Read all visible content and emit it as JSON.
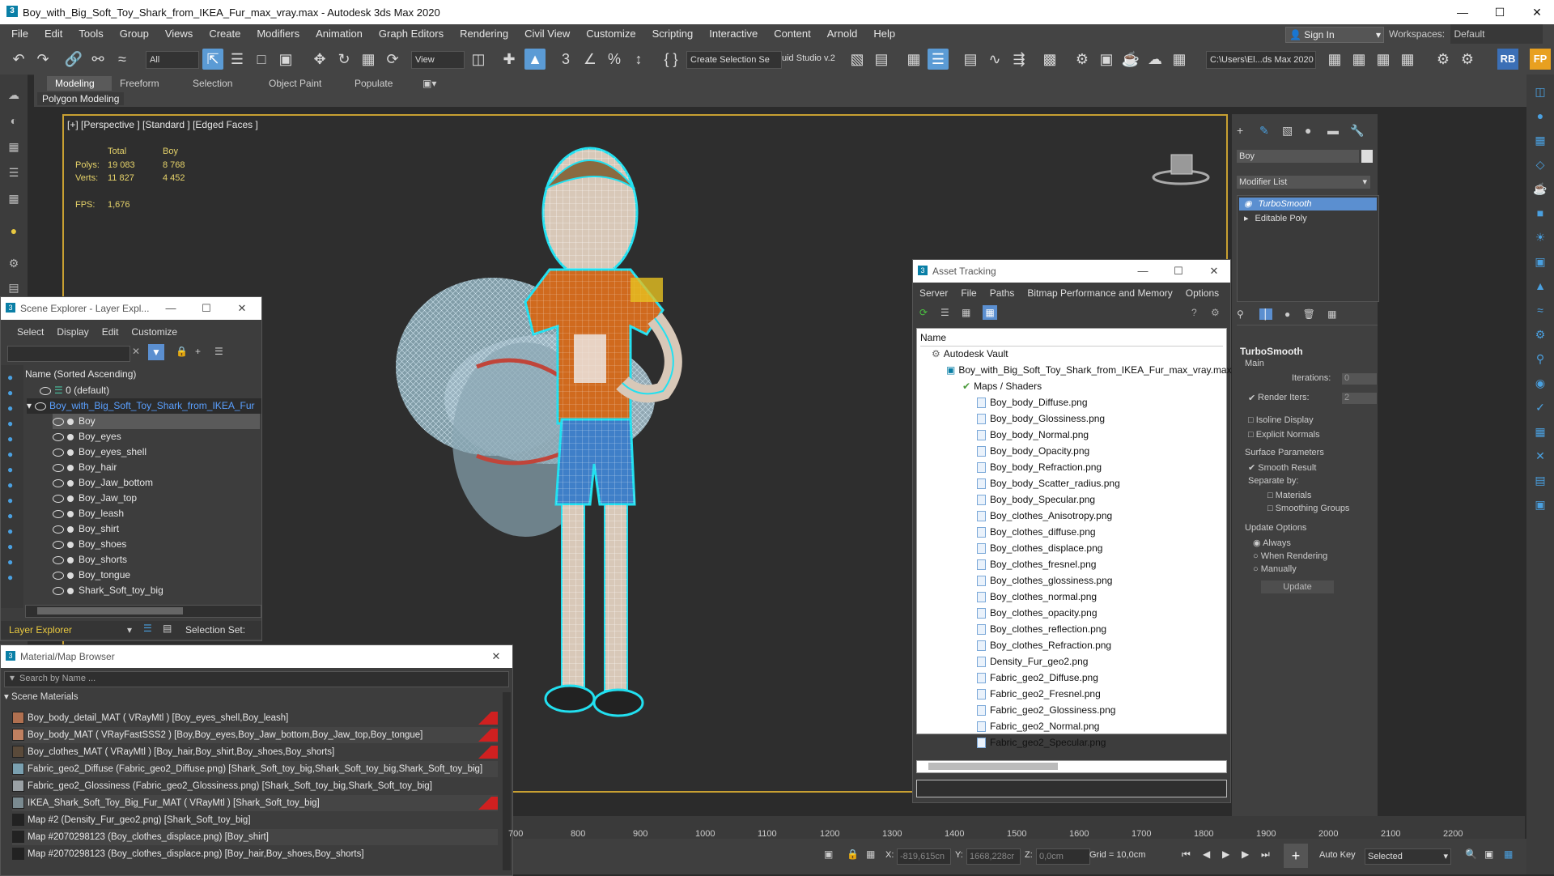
{
  "window": {
    "title": "Boy_with_Big_Soft_Toy_Shark_from_IKEA_Fur_max_vray.max - Autodesk 3ds Max 2020",
    "minimize_icon": "minimize-icon",
    "maximize_icon": "maximize-icon",
    "close_icon": "close-icon"
  },
  "menubar": {
    "items": [
      "File",
      "Edit",
      "Tools",
      "Group",
      "Views",
      "Create",
      "Modifiers",
      "Animation",
      "Graph Editors",
      "Rendering",
      "Civil View",
      "Customize",
      "Scripting",
      "Interactive",
      "Content",
      "Arnold",
      "Help"
    ],
    "signin": "Sign In",
    "workspaces_label": "Workspaces:",
    "workspaces_value": "Default"
  },
  "toolbar": {
    "filter_value": "All",
    "view_value": "View",
    "selection_set": "Create Selection Se",
    "studio_text": "uid Studio v.2",
    "path_value": "C:\\Users\\El...ds Max 2020"
  },
  "ribbon": {
    "tabs": [
      "Modeling",
      "Freeform",
      "Selection",
      "Object Paint",
      "Populate"
    ],
    "sub_label": "Polygon Modeling"
  },
  "viewport": {
    "label": "[+] [Perspective ] [Standard ] [Edged Faces ]",
    "stats": {
      "header_total": "Total",
      "header_boy": "Boy",
      "polys_label": "Polys:",
      "polys_total": "19 083",
      "polys_boy": "8 768",
      "verts_label": "Verts:",
      "verts_total": "11 827",
      "verts_boy": "4 452",
      "fps_label": "FPS:",
      "fps_value": "1,676"
    }
  },
  "scene_explorer": {
    "title": "Scene Explorer - Layer Expl...",
    "menus": [
      "Select",
      "Display",
      "Edit",
      "Customize"
    ],
    "column_header": "Name (Sorted Ascending)",
    "default_layer": "0 (default)",
    "root": "Boy_with_Big_Soft_Toy_Shark_from_IKEA_Fur",
    "items": [
      "Boy",
      "Boy_eyes",
      "Boy_eyes_shell",
      "Boy_hair",
      "Boy_Jaw_bottom",
      "Boy_Jaw_top",
      "Boy_leash",
      "Boy_shirt",
      "Boy_shoes",
      "Boy_shorts",
      "Boy_tongue",
      "Shark_Soft_toy_big"
    ],
    "footer_layer": "Layer Explorer",
    "footer_selset": "Selection Set:"
  },
  "material_browser": {
    "title": "Material/Map Browser",
    "search_placeholder": "Search by Name ...",
    "section": "Scene Materials",
    "items": [
      "Boy_body_detail_MAT ( VRayMtl ) [Boy_eyes_shell,Boy_leash]",
      "Boy_body_MAT ( VRayFastSSS2 ) [Boy,Boy_eyes,Boy_Jaw_bottom,Boy_Jaw_top,Boy_tongue]",
      "Boy_clothes_MAT ( VRayMtl ) [Boy_hair,Boy_shirt,Boy_shoes,Boy_shorts]",
      "Fabric_geo2_Diffuse (Fabric_geo2_Diffuse.png) [Shark_Soft_toy_big,Shark_Soft_toy_big,Shark_Soft_toy_big]",
      "Fabric_geo2_Glossiness (Fabric_geo2_Glossiness.png) [Shark_Soft_toy_big,Shark_Soft_toy_big]",
      "IKEA_Shark_Soft_Toy_Big_Fur_MAT ( VRayMtl ) [Shark_Soft_toy_big]",
      "Map #2 (Density_Fur_geo2.png) [Shark_Soft_toy_big]",
      "Map #2070298123 (Boy_clothes_displace.png) [Boy_shirt]",
      "Map #2070298123 (Boy_clothes_displace.png) [Boy_hair,Boy_shoes,Boy_shorts]"
    ]
  },
  "asset_tracking": {
    "title": "Asset Tracking",
    "menus": [
      "Server",
      "File",
      "Paths",
      "Bitmap Performance and Memory",
      "Options"
    ],
    "column_header": "Name",
    "vault": "Autodesk Vault",
    "file": "Boy_with_Big_Soft_Toy_Shark_from_IKEA_Fur_max_vray.max",
    "maps_folder": "Maps / Shaders",
    "maps": [
      "Boy_body_Diffuse.png",
      "Boy_body_Glossiness.png",
      "Boy_body_Normal.png",
      "Boy_body_Opacity.png",
      "Boy_body_Refraction.png",
      "Boy_body_Scatter_radius.png",
      "Boy_body_Specular.png",
      "Boy_clothes_Anisotropy.png",
      "Boy_clothes_diffuse.png",
      "Boy_clothes_displace.png",
      "Boy_clothes_fresnel.png",
      "Boy_clothes_glossiness.png",
      "Boy_clothes_normal.png",
      "Boy_clothes_opacity.png",
      "Boy_clothes_reflection.png",
      "Boy_clothes_Refraction.png",
      "Density_Fur_geo2.png",
      "Fabric_geo2_Diffuse.png",
      "Fabric_geo2_Fresnel.png",
      "Fabric_geo2_Glossiness.png",
      "Fabric_geo2_Normal.png",
      "Fabric_geo2_Specular.png"
    ]
  },
  "command_panel": {
    "object_name": "Boy",
    "modifier_list": "Modifier List",
    "stack": [
      "TurboSmooth",
      "Editable Poly"
    ],
    "rollout_title": "TurboSmooth",
    "main_label": "Main",
    "iterations_label": "Iterations:",
    "iterations_value": "0",
    "render_iters_label": "Render Iters:",
    "render_iters_value": "2",
    "isoline": "Isoline Display",
    "explicit_normals": "Explicit Normals",
    "surface_params": "Surface Parameters",
    "smooth_result": "Smooth Result",
    "separate_by": "Separate by:",
    "materials": "Materials",
    "smoothing_groups": "Smoothing Groups",
    "update_options": "Update Options",
    "always": "Always",
    "when_rendering": "When Rendering",
    "manually": "Manually",
    "update_button": "Update"
  },
  "timeline": {
    "ticks": [
      "700",
      "800",
      "900",
      "1000",
      "1100",
      "1200",
      "1300",
      "1400",
      "1500",
      "1600",
      "1700",
      "1800",
      "1900",
      "2000",
      "2100",
      "2200"
    ]
  },
  "statusbar": {
    "x_label": "X:",
    "x_value": "-819,615cn",
    "y_label": "Y:",
    "y_value": "1668,228cr",
    "z_label": "Z:",
    "z_value": "0,0cm",
    "grid": "Grid = 10,0cm",
    "autokey": "Auto Key",
    "selected": "Selected"
  }
}
